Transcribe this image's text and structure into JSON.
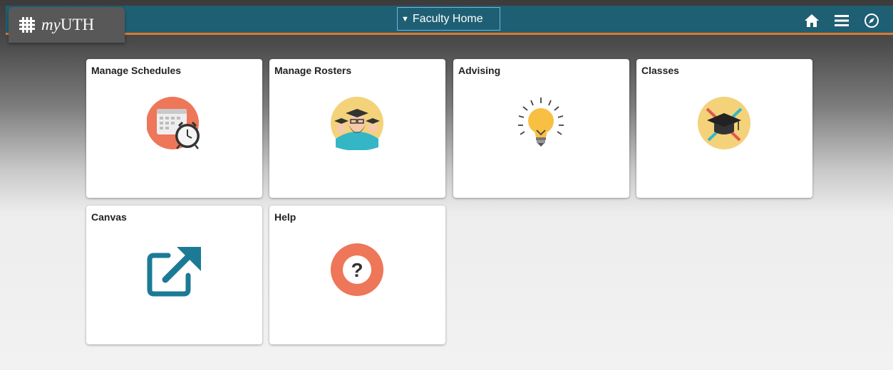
{
  "header": {
    "brand": {
      "prefix": "my",
      "name": "UTH",
      "icon": "utd-logo-icon"
    },
    "dropdown": {
      "label": "Faculty Home",
      "icon": "caret-down-icon"
    },
    "actions": [
      {
        "name": "home",
        "icon": "home-icon"
      },
      {
        "name": "menu",
        "icon": "hamburger-icon"
      },
      {
        "name": "navbar",
        "icon": "compass-icon"
      }
    ],
    "colors": {
      "bar": "#1f5f73",
      "accent": "#e07a2b",
      "brand_tab": "#585858"
    }
  },
  "tiles": [
    {
      "label": "Manage Schedules",
      "icon": "calendar-clock-icon"
    },
    {
      "label": "Manage Rosters",
      "icon": "students-icon"
    },
    {
      "label": "Advising",
      "icon": "lightbulb-icon"
    },
    {
      "label": "Classes",
      "icon": "graduation-cap-icon"
    },
    {
      "label": "Canvas",
      "icon": "external-link-icon"
    },
    {
      "label": "Help",
      "icon": "question-icon"
    }
  ]
}
